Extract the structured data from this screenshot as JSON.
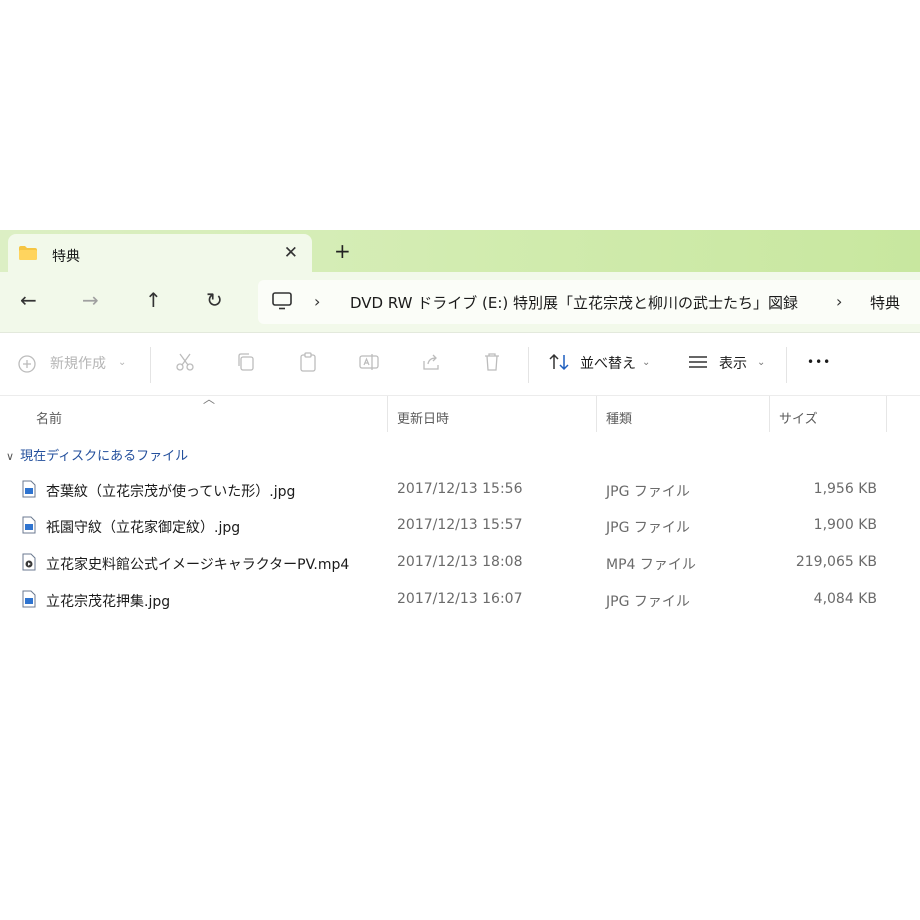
{
  "tab": {
    "title": "特典",
    "close": "✕",
    "new_tab": "+"
  },
  "nav": {
    "back": "←",
    "forward": "→",
    "up": "↑",
    "refresh": "↻"
  },
  "breadcrumb": {
    "items": [
      "DVD RW ドライブ (E:) 特別展「立花宗茂と柳川の武士たち」図録",
      "特典"
    ],
    "separator": "›"
  },
  "toolbar": {
    "new_label": "新規作成",
    "sort_label": "並べ替え",
    "view_label": "表示",
    "more_label": "•••"
  },
  "columns": {
    "name": "名前",
    "date": "更新日時",
    "type": "種類",
    "size": "サイズ"
  },
  "group": {
    "label": "現在ディスクにあるファイル"
  },
  "files": [
    {
      "name": "杏葉紋（立花宗茂が使っていた形）.jpg",
      "date": "2017/12/13 15:56",
      "type": "JPG ファイル",
      "size": "1,956 KB",
      "icon": "image-file-icon"
    },
    {
      "name": "祇園守紋（立花家御定紋）.jpg",
      "date": "2017/12/13 15:57",
      "type": "JPG ファイル",
      "size": "1,900 KB",
      "icon": "image-file-icon"
    },
    {
      "name": "立花家史料館公式イメージキャラクターPV.mp4",
      "date": "2017/12/13 18:08",
      "type": "MP4 ファイル",
      "size": "219,065 KB",
      "icon": "video-file-icon"
    },
    {
      "name": "立花宗茂花押集.jpg",
      "date": "2017/12/13 16:07",
      "type": "JPG ファイル",
      "size": "4,084 KB",
      "icon": "image-file-icon"
    }
  ],
  "colors": {
    "tab_strip": "#d2ecb0",
    "toolbar_bg": "#f2f9ea",
    "group_text": "#234f9c"
  }
}
